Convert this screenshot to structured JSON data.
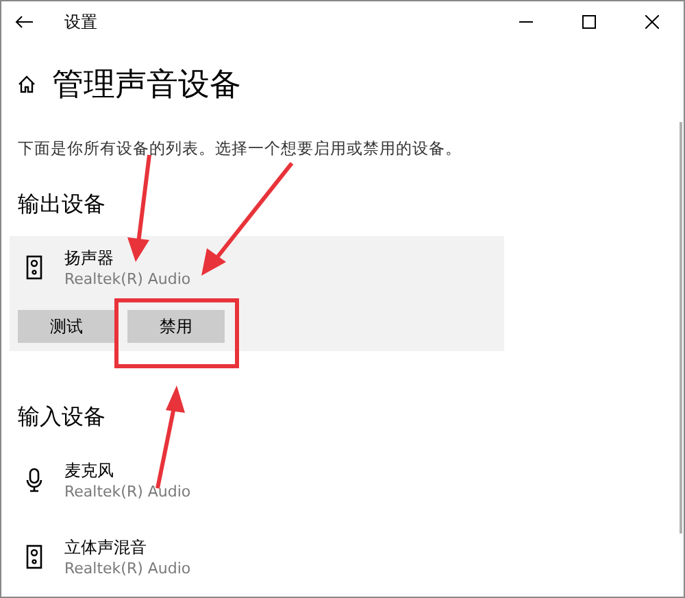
{
  "window": {
    "title": "设置"
  },
  "page": {
    "title": "管理声音设备",
    "description": "下面是你所有设备的列表。选择一个想要启用或禁用的设备。"
  },
  "sections": [
    {
      "title": "输出设备",
      "devices": [
        {
          "kind": "speaker",
          "name": "扬声器",
          "driver": "Realtek(R) Audio",
          "selected": true,
          "buttons": [
            "测试",
            "禁用"
          ]
        }
      ]
    },
    {
      "title": "输入设备",
      "devices": [
        {
          "kind": "microphone",
          "name": "麦克风",
          "driver": "Realtek(R) Audio",
          "selected": false
        },
        {
          "kind": "speaker",
          "name": "立体声混音",
          "driver": "Realtek(R) Audio",
          "selected": false
        }
      ]
    }
  ]
}
